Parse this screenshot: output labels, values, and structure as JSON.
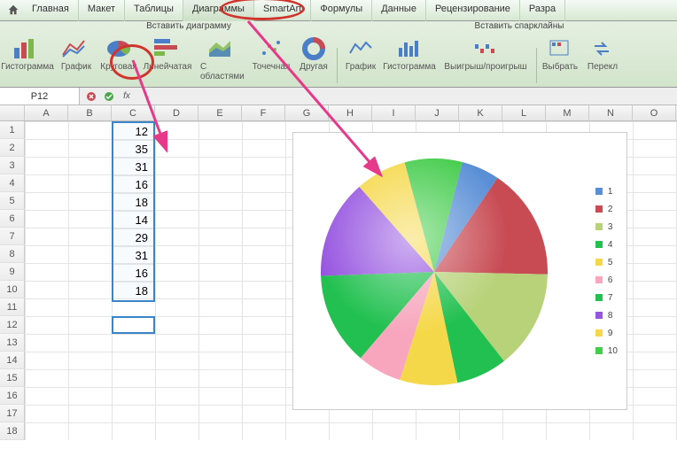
{
  "tabs": {
    "home": "Главная",
    "layout": "Макет",
    "tables": "Таблицы",
    "charts": "Диаграммы",
    "smartart": "SmartArt",
    "formulas": "Формулы",
    "data": "Данные",
    "review": "Рецензирование",
    "dev": "Разра"
  },
  "ribbon": {
    "group_insert_chart": "Вставить диаграмму",
    "group_sparklines": "Вставить спарклайны",
    "items": {
      "column": "Гистограмма",
      "line": "График",
      "pie": "Круговая",
      "bar": "Линейчатая",
      "area": "С областями",
      "scatter": "Точечная",
      "other": "Другая",
      "spark_line": "График",
      "spark_col": "Гистограмма",
      "spark_winloss": "Выигрыш/проигрыш",
      "select": "Выбрать",
      "switch": "Перекл"
    }
  },
  "formula_bar": {
    "name_box": "P12",
    "fx": "fx"
  },
  "columns": [
    "A",
    "B",
    "C",
    "D",
    "E",
    "F",
    "G",
    "H",
    "I",
    "J",
    "K",
    "L",
    "M",
    "N",
    "O"
  ],
  "rows": [
    "1",
    "2",
    "3",
    "4",
    "5",
    "6",
    "7",
    "8",
    "9",
    "10",
    "11",
    "12",
    "13",
    "14",
    "15",
    "16",
    "17",
    "18"
  ],
  "chart_data": {
    "type": "pie",
    "categories": [
      "1",
      "2",
      "3",
      "4",
      "5",
      "6",
      "7",
      "8",
      "9",
      "10"
    ],
    "values": [
      12,
      35,
      31,
      16,
      18,
      14,
      29,
      31,
      16,
      18
    ],
    "colors": [
      "#5a8fd6",
      "#c84b54",
      "#b8d27a",
      "#22c050",
      "#f5d84a",
      "#f7a6bd",
      "#22c050",
      "#9655e0",
      "#f5d84a",
      "#43cc4b"
    ],
    "legend_pos": "right"
  },
  "callouts": {
    "circle_tab": "Диаграммы",
    "circle_button": "Круговая"
  }
}
